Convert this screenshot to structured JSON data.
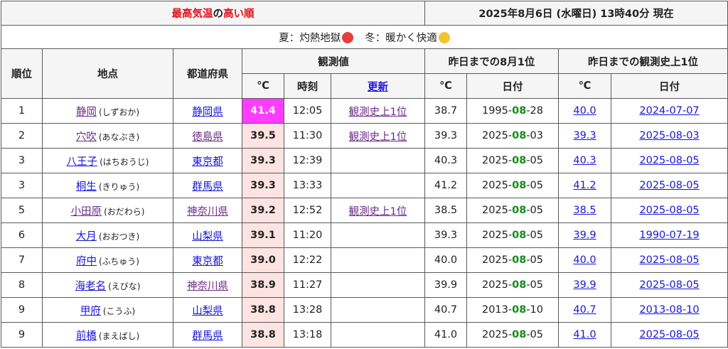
{
  "header": {
    "title_part1": "最高気温",
    "title_part2": "の",
    "title_part3": "高い順",
    "timestamp": "2025年8月6日 (水曜日) 13時40分 現在"
  },
  "legend": {
    "summer": "夏：灼熱地獄",
    "winter": "冬：暖かく快適",
    "summer_icon": "angry-face-icon",
    "winter_icon": "neutral-face-icon"
  },
  "columns": {
    "rank": "順位",
    "location": "地点",
    "prefecture": "都道府県",
    "observed": "観測値",
    "yesterday_aug_first": "昨日までの8月1位",
    "yesterday_record_first": "昨日までの観測史上1位",
    "celsius": "℃",
    "time": "時刻",
    "update": "更新",
    "date": "日付"
  },
  "rows": [
    {
      "rank": "1",
      "place": "静岡",
      "kana": "(しずおか)",
      "pref": "静岡県",
      "temp": "41.4",
      "time": "12:05",
      "note": "観測史上1位",
      "aug_temp": "38.7",
      "aug_y": "1995-",
      "aug_m": "08",
      "aug_d": "-28",
      "rec_temp": "40.0",
      "rec_date": "2024-07-07",
      "place_visited": true,
      "pref_visited": false
    },
    {
      "rank": "2",
      "place": "穴吹",
      "kana": "(あなぶき)",
      "pref": "徳島県",
      "temp": "39.5",
      "time": "11:30",
      "note": "観測史上1位",
      "aug_temp": "39.3",
      "aug_y": "2025-",
      "aug_m": "08",
      "aug_d": "-03",
      "rec_temp": "39.3",
      "rec_date": "2025-08-03",
      "place_visited": true,
      "pref_visited": true
    },
    {
      "rank": "3",
      "place": "八王子",
      "kana": "(はちおうじ)",
      "pref": "東京都",
      "temp": "39.3",
      "time": "12:39",
      "note": "",
      "aug_temp": "40.3",
      "aug_y": "2025-",
      "aug_m": "08",
      "aug_d": "-05",
      "rec_temp": "40.3",
      "rec_date": "2025-08-05",
      "place_visited": false,
      "pref_visited": false
    },
    {
      "rank": "3",
      "place": "桐生",
      "kana": "(きりゅう)",
      "pref": "群馬県",
      "temp": "39.3",
      "time": "13:33",
      "note": "",
      "aug_temp": "41.2",
      "aug_y": "2025-",
      "aug_m": "08",
      "aug_d": "-05",
      "rec_temp": "41.2",
      "rec_date": "2025-08-05",
      "place_visited": false,
      "pref_visited": false
    },
    {
      "rank": "5",
      "place": "小田原",
      "kana": "(おだわら)",
      "pref": "神奈川県",
      "temp": "39.2",
      "time": "12:52",
      "note": "観測史上1位",
      "aug_temp": "38.5",
      "aug_y": "2025-",
      "aug_m": "08",
      "aug_d": "-05",
      "rec_temp": "38.5",
      "rec_date": "2025-08-05",
      "place_visited": true,
      "pref_visited": true
    },
    {
      "rank": "6",
      "place": "大月",
      "kana": "(おおつき)",
      "pref": "山梨県",
      "temp": "39.1",
      "time": "11:20",
      "note": "",
      "aug_temp": "39.3",
      "aug_y": "2025-",
      "aug_m": "08",
      "aug_d": "-05",
      "rec_temp": "39.9",
      "rec_date": "1990-07-19",
      "place_visited": false,
      "pref_visited": false
    },
    {
      "rank": "7",
      "place": "府中",
      "kana": "(ふちゅう)",
      "pref": "東京都",
      "temp": "39.0",
      "time": "12:22",
      "note": "",
      "aug_temp": "40.0",
      "aug_y": "2025-",
      "aug_m": "08",
      "aug_d": "-05",
      "rec_temp": "40.0",
      "rec_date": "2025-08-05",
      "place_visited": false,
      "pref_visited": false
    },
    {
      "rank": "8",
      "place": "海老名",
      "kana": "(えびな)",
      "pref": "神奈川県",
      "temp": "38.9",
      "time": "11:27",
      "note": "",
      "aug_temp": "39.9",
      "aug_y": "2025-",
      "aug_m": "08",
      "aug_d": "-05",
      "rec_temp": "39.9",
      "rec_date": "2025-08-05",
      "place_visited": false,
      "pref_visited": true
    },
    {
      "rank": "9",
      "place": "甲府",
      "kana": "(こうふ)",
      "pref": "山梨県",
      "temp": "38.8",
      "time": "13:28",
      "note": "",
      "aug_temp": "40.7",
      "aug_y": "2013-",
      "aug_m": "08",
      "aug_d": "-10",
      "rec_temp": "40.7",
      "rec_date": "2013-08-10",
      "place_visited": false,
      "pref_visited": false
    },
    {
      "rank": "9",
      "place": "前橋",
      "kana": "(まえばし)",
      "pref": "群馬県",
      "temp": "38.8",
      "time": "13:18",
      "note": "",
      "aug_temp": "41.0",
      "aug_y": "2025-",
      "aug_m": "08",
      "aug_d": "-05",
      "rec_temp": "41.0",
      "rec_date": "2025-08-05",
      "place_visited": false,
      "pref_visited": false
    }
  ],
  "colors": {
    "title_red": "#e0121c",
    "link_blue": "#1a16d6",
    "visited_purple": "#6b2a86",
    "top_temp_bg": "#ff3cff",
    "temp_bg": "#fde4e2",
    "month_green": "#168b1c"
  }
}
